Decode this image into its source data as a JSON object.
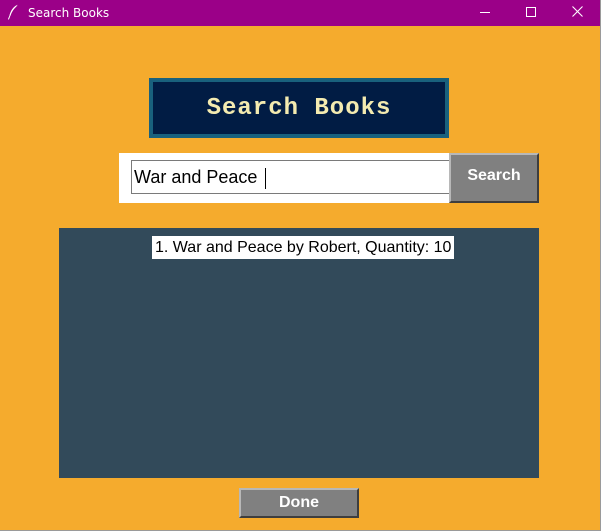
{
  "window": {
    "title": "Search Books",
    "icon": "feather-icon",
    "controls": {
      "minimize_icon": "minimize-icon",
      "maximize_icon": "maximize-icon",
      "close_icon": "close-icon"
    }
  },
  "heading": {
    "text": "Search Books"
  },
  "search": {
    "value": "War and Peace",
    "button_label": "Search"
  },
  "results": {
    "items": [
      {
        "label": "1. War and Peace by Robert, Quantity: 10"
      }
    ]
  },
  "footer": {
    "done_label": "Done"
  },
  "colors": {
    "titlebar": "#9b0088",
    "background": "#f5ab2d",
    "heading_bg": "#011c44",
    "heading_border": "#19617d",
    "heading_text": "#f4ebb0",
    "button_bg": "#808080",
    "results_bg": "#324a5a"
  }
}
